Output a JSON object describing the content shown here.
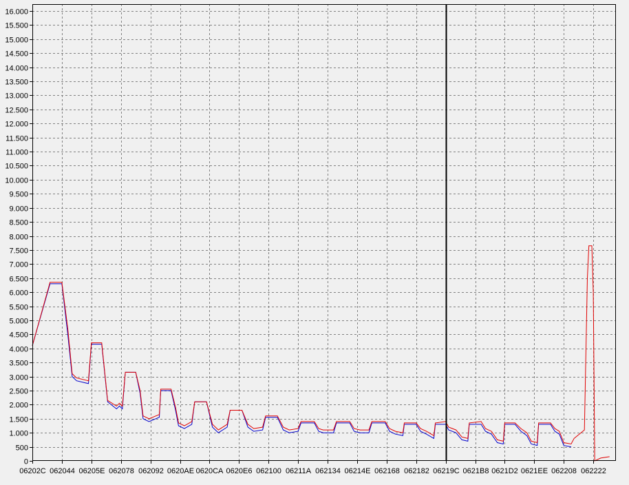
{
  "chart_data": {
    "type": "line",
    "title": "",
    "xlabel": "",
    "ylabel": "",
    "ylim": [
      0,
      16000
    ],
    "y_ticks": [
      0,
      500,
      1000,
      1500,
      2000,
      2500,
      3000,
      3500,
      4000,
      4500,
      5000,
      5500,
      6000,
      6500,
      7000,
      7500,
      8000,
      8500,
      9000,
      9500,
      10000,
      10500,
      11000,
      11500,
      12000,
      12500,
      13000,
      13500,
      14000,
      14500,
      15000,
      15500,
      16000
    ],
    "y_tick_labels": [
      "0",
      "500",
      "1.000",
      "1.500",
      "2.000",
      "2.500",
      "3.000",
      "3.500",
      "4.000",
      "4.500",
      "5.000",
      "5.500",
      "6.000",
      "6.500",
      "7.000",
      "7.500",
      "8.000",
      "8.500",
      "9.000",
      "9.500",
      "10.000",
      "10.500",
      "11.000",
      "11.500",
      "12.000",
      "12.500",
      "13.000",
      "13.500",
      "14.000",
      "14.500",
      "15.000",
      "15.500",
      "16.000"
    ],
    "x_tick_labels": [
      "06202C",
      "062044",
      "06205E",
      "062078",
      "062092",
      "0620AE",
      "0620CA",
      "0620E6",
      "062100",
      "06211A",
      "062134",
      "06214E",
      "062168",
      "062182",
      "06219C",
      "0621B8",
      "0621D2",
      "0621EE",
      "062208",
      "062222"
    ],
    "grid": true,
    "cursor_label": "06219C",
    "series": [
      {
        "color": "#0000cc",
        "points": [
          [
            0,
            4100
          ],
          [
            0.6,
            6300
          ],
          [
            1.0,
            6300
          ],
          [
            1.2,
            4500
          ],
          [
            1.35,
            3000
          ],
          [
            1.5,
            2850
          ],
          [
            1.9,
            2750
          ],
          [
            2.0,
            4150
          ],
          [
            2.35,
            4150
          ],
          [
            2.55,
            2100
          ],
          [
            2.85,
            1850
          ],
          [
            2.95,
            1950
          ],
          [
            3.05,
            1850
          ],
          [
            3.15,
            3150
          ],
          [
            3.5,
            3150
          ],
          [
            3.65,
            2400
          ],
          [
            3.75,
            1500
          ],
          [
            3.95,
            1400
          ],
          [
            4.3,
            1550
          ],
          [
            4.35,
            2500
          ],
          [
            4.7,
            2500
          ],
          [
            4.85,
            1800
          ],
          [
            4.95,
            1250
          ],
          [
            5.15,
            1150
          ],
          [
            5.4,
            1300
          ],
          [
            5.5,
            2100
          ],
          [
            5.9,
            2100
          ],
          [
            6.1,
            1200
          ],
          [
            6.3,
            1000
          ],
          [
            6.6,
            1200
          ],
          [
            6.7,
            1800
          ],
          [
            7.1,
            1800
          ],
          [
            7.3,
            1200
          ],
          [
            7.5,
            1050
          ],
          [
            7.8,
            1100
          ],
          [
            7.9,
            1550
          ],
          [
            8.3,
            1550
          ],
          [
            8.5,
            1100
          ],
          [
            8.7,
            1000
          ],
          [
            9.0,
            1050
          ],
          [
            9.1,
            1350
          ],
          [
            9.55,
            1350
          ],
          [
            9.7,
            1050
          ],
          [
            9.85,
            1000
          ],
          [
            10.2,
            1000
          ],
          [
            10.3,
            1350
          ],
          [
            10.75,
            1350
          ],
          [
            10.9,
            1050
          ],
          [
            11.1,
            1000
          ],
          [
            11.4,
            1000
          ],
          [
            11.5,
            1350
          ],
          [
            11.95,
            1350
          ],
          [
            12.1,
            1050
          ],
          [
            12.3,
            950
          ],
          [
            12.55,
            900
          ],
          [
            12.6,
            1300
          ],
          [
            13.0,
            1300
          ],
          [
            13.15,
            1050
          ],
          [
            13.35,
            950
          ],
          [
            13.6,
            800
          ],
          [
            13.65,
            1300
          ],
          [
            14.0,
            1300
          ],
          [
            14.1,
            1100
          ],
          [
            14.35,
            1000
          ],
          [
            14.55,
            750
          ],
          [
            14.75,
            700
          ],
          [
            14.8,
            1300
          ],
          [
            15.2,
            1300
          ],
          [
            15.35,
            1050
          ],
          [
            15.55,
            950
          ],
          [
            15.75,
            650
          ],
          [
            15.95,
            600
          ],
          [
            16.0,
            1300
          ],
          [
            16.35,
            1300
          ],
          [
            16.55,
            1050
          ],
          [
            16.75,
            900
          ],
          [
            16.9,
            600
          ],
          [
            17.1,
            550
          ],
          [
            17.15,
            1300
          ],
          [
            17.55,
            1300
          ],
          [
            17.7,
            1050
          ],
          [
            17.85,
            950
          ],
          [
            18.0,
            550
          ],
          [
            18.25,
            500
          ]
        ]
      },
      {
        "color": "#e00000",
        "points": [
          [
            0,
            4100
          ],
          [
            0.6,
            6350
          ],
          [
            1.0,
            6350
          ],
          [
            1.2,
            4700
          ],
          [
            1.35,
            3100
          ],
          [
            1.5,
            2950
          ],
          [
            1.9,
            2850
          ],
          [
            2.0,
            4200
          ],
          [
            2.35,
            4200
          ],
          [
            2.55,
            2150
          ],
          [
            2.85,
            1950
          ],
          [
            2.95,
            2050
          ],
          [
            3.05,
            1950
          ],
          [
            3.15,
            3150
          ],
          [
            3.5,
            3150
          ],
          [
            3.65,
            2500
          ],
          [
            3.75,
            1600
          ],
          [
            3.95,
            1500
          ],
          [
            4.3,
            1650
          ],
          [
            4.35,
            2550
          ],
          [
            4.7,
            2550
          ],
          [
            4.85,
            1900
          ],
          [
            4.95,
            1350
          ],
          [
            5.15,
            1250
          ],
          [
            5.4,
            1400
          ],
          [
            5.5,
            2100
          ],
          [
            5.9,
            2100
          ],
          [
            6.1,
            1300
          ],
          [
            6.3,
            1100
          ],
          [
            6.6,
            1300
          ],
          [
            6.7,
            1800
          ],
          [
            7.1,
            1800
          ],
          [
            7.3,
            1300
          ],
          [
            7.5,
            1150
          ],
          [
            7.8,
            1200
          ],
          [
            7.9,
            1600
          ],
          [
            8.3,
            1600
          ],
          [
            8.5,
            1200
          ],
          [
            8.7,
            1100
          ],
          [
            9.0,
            1150
          ],
          [
            9.1,
            1400
          ],
          [
            9.55,
            1400
          ],
          [
            9.7,
            1150
          ],
          [
            9.85,
            1100
          ],
          [
            10.2,
            1100
          ],
          [
            10.3,
            1400
          ],
          [
            10.75,
            1400
          ],
          [
            10.9,
            1150
          ],
          [
            11.1,
            1100
          ],
          [
            11.4,
            1100
          ],
          [
            11.5,
            1400
          ],
          [
            11.95,
            1400
          ],
          [
            12.1,
            1150
          ],
          [
            12.3,
            1050
          ],
          [
            12.55,
            1000
          ],
          [
            12.6,
            1350
          ],
          [
            13.0,
            1350
          ],
          [
            13.15,
            1150
          ],
          [
            13.35,
            1050
          ],
          [
            13.6,
            900
          ],
          [
            13.65,
            1350
          ],
          [
            14.0,
            1400
          ],
          [
            14.1,
            1200
          ],
          [
            14.35,
            1100
          ],
          [
            14.55,
            850
          ],
          [
            14.75,
            800
          ],
          [
            14.8,
            1350
          ],
          [
            15.2,
            1400
          ],
          [
            15.35,
            1150
          ],
          [
            15.55,
            1050
          ],
          [
            15.75,
            750
          ],
          [
            15.95,
            700
          ],
          [
            16.0,
            1350
          ],
          [
            16.35,
            1350
          ],
          [
            16.55,
            1150
          ],
          [
            16.75,
            1000
          ],
          [
            16.9,
            700
          ],
          [
            17.1,
            650
          ],
          [
            17.15,
            1350
          ],
          [
            17.55,
            1350
          ],
          [
            17.7,
            1150
          ],
          [
            17.85,
            1050
          ],
          [
            18.0,
            650
          ],
          [
            18.25,
            600
          ],
          [
            18.35,
            800
          ],
          [
            18.7,
            1100
          ],
          [
            18.8,
            6500
          ],
          [
            18.85,
            7650
          ],
          [
            18.95,
            7650
          ],
          [
            19.0,
            6000
          ],
          [
            19.05,
            0
          ],
          [
            19.25,
            100
          ],
          [
            19.55,
            150
          ]
        ]
      }
    ]
  }
}
